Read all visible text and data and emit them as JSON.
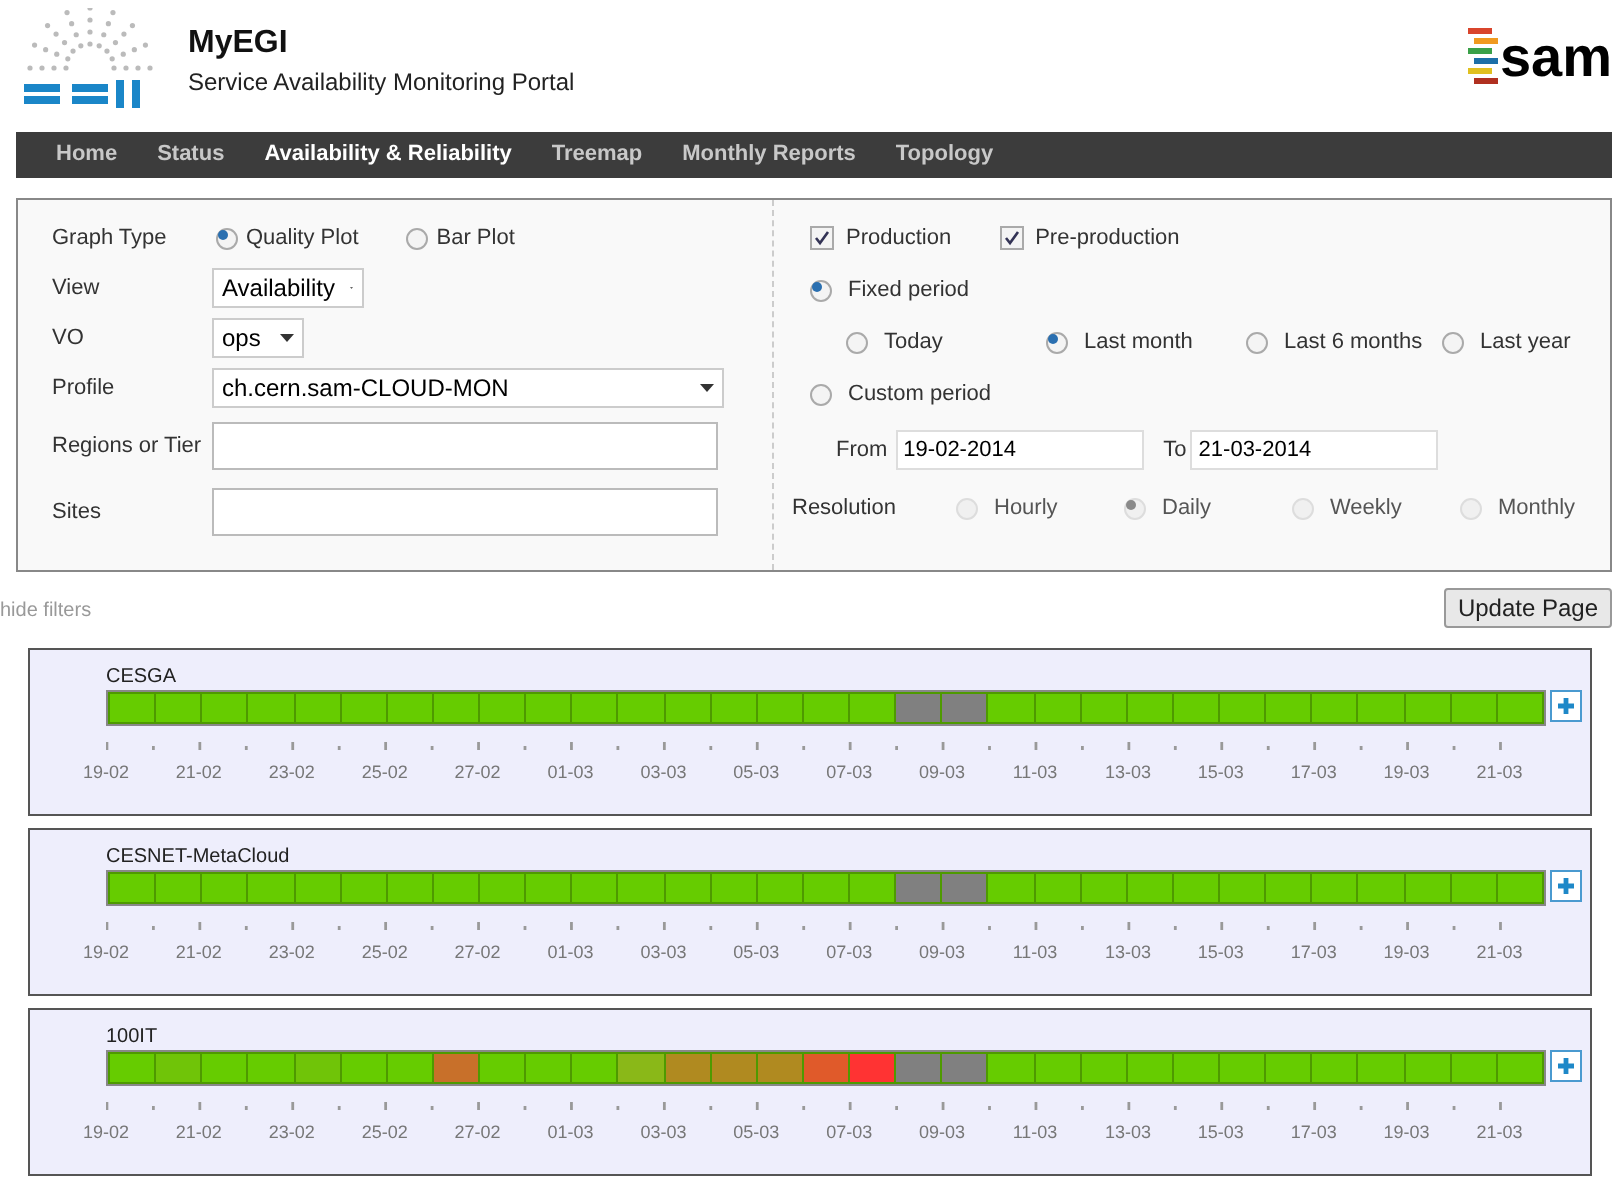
{
  "header": {
    "logo_text": "MyEGI",
    "subtitle": "Service Availability Monitoring Portal",
    "brand": "sam"
  },
  "nav": [
    {
      "label": "Home",
      "selected": false
    },
    {
      "label": "Status",
      "selected": false
    },
    {
      "label": "Availability & Reliability",
      "selected": true
    },
    {
      "label": "Treemap",
      "selected": false
    },
    {
      "label": "Monthly Reports",
      "selected": false
    },
    {
      "label": "Topology",
      "selected": false
    }
  ],
  "filters": {
    "graph_type": {
      "label": "Graph Type",
      "options": [
        {
          "label": "Quality Plot",
          "selected": true
        },
        {
          "label": "Bar Plot",
          "selected": false
        }
      ]
    },
    "view": {
      "label": "View",
      "value": "Availability"
    },
    "vo": {
      "label": "VO",
      "value": "ops"
    },
    "profile": {
      "label": "Profile",
      "value": "ch.cern.sam-CLOUD-MON"
    },
    "regions": {
      "label": "Regions or Tier"
    },
    "sites": {
      "label": "Sites"
    },
    "checks": [
      {
        "label": "Production",
        "checked": true
      },
      {
        "label": "Pre-production",
        "checked": true
      }
    ],
    "fixed_period": {
      "label": "Fixed period",
      "selected": true,
      "options": [
        {
          "label": "Today",
          "selected": false
        },
        {
          "label": "Last month",
          "selected": true
        },
        {
          "label": "Last 6 months",
          "selected": false
        },
        {
          "label": "Last year",
          "selected": false
        }
      ]
    },
    "custom_period": {
      "label": "Custom period",
      "selected": false,
      "from_label": "From",
      "from": "19-02-2014",
      "to_label": "To",
      "to": "21-03-2014"
    },
    "resolution": {
      "label": "Resolution",
      "disabled": true,
      "options": [
        {
          "label": "Hourly",
          "selected": false
        },
        {
          "label": "Daily",
          "selected": true
        },
        {
          "label": "Weekly",
          "selected": false
        },
        {
          "label": "Monthly",
          "selected": false
        }
      ]
    }
  },
  "hide_filters": "hide filters",
  "update_button": "Update Page",
  "sites": [
    {
      "name": "CESGA",
      "days": [
        {
          "color": "#66cc00"
        },
        {
          "color": "#66cc00"
        },
        {
          "color": "#66cc00"
        },
        {
          "color": "#66cc00"
        },
        {
          "color": "#66cc00"
        },
        {
          "color": "#66cc00"
        },
        {
          "color": "#66cc00"
        },
        {
          "color": "#66cc00"
        },
        {
          "color": "#66cc00"
        },
        {
          "color": "#66cc00"
        },
        {
          "color": "#66cc00"
        },
        {
          "color": "#66cc00"
        },
        {
          "color": "#66cc00"
        },
        {
          "color": "#66cc00"
        },
        {
          "color": "#66cc00"
        },
        {
          "color": "#66cc00"
        },
        {
          "color": "#66cc00"
        },
        {
          "color": "#808080"
        },
        {
          "color": "#808080"
        },
        {
          "color": "#66cc00"
        },
        {
          "color": "#66cc00"
        },
        {
          "color": "#66cc00"
        },
        {
          "color": "#66cc00"
        },
        {
          "color": "#66cc00"
        },
        {
          "color": "#66cc00"
        },
        {
          "color": "#66cc00"
        },
        {
          "color": "#66cc00"
        },
        {
          "color": "#66cc00"
        },
        {
          "color": "#66cc00"
        },
        {
          "color": "#66cc00"
        },
        {
          "color": "#66cc00"
        }
      ],
      "ticks": [
        "19-02",
        "21-02",
        "23-02",
        "25-02",
        "27-02",
        "01-03",
        "03-03",
        "05-03",
        "07-03",
        "09-03",
        "11-03",
        "13-03",
        "15-03",
        "17-03",
        "19-03",
        "21-03"
      ]
    },
    {
      "name": "CESNET-MetaCloud",
      "days": [
        {
          "color": "#66cc00"
        },
        {
          "color": "#66cc00"
        },
        {
          "color": "#66cc00"
        },
        {
          "color": "#66cc00"
        },
        {
          "color": "#66cc00"
        },
        {
          "color": "#66cc00"
        },
        {
          "color": "#66cc00"
        },
        {
          "color": "#66cc00"
        },
        {
          "color": "#66cc00"
        },
        {
          "color": "#66cc00"
        },
        {
          "color": "#66cc00"
        },
        {
          "color": "#66cc00"
        },
        {
          "color": "#66cc00"
        },
        {
          "color": "#66cc00"
        },
        {
          "color": "#66cc00"
        },
        {
          "color": "#66cc00"
        },
        {
          "color": "#66cc00"
        },
        {
          "color": "#808080"
        },
        {
          "color": "#808080"
        },
        {
          "color": "#66cc00"
        },
        {
          "color": "#66cc00"
        },
        {
          "color": "#66cc00"
        },
        {
          "color": "#66cc00"
        },
        {
          "color": "#66cc00"
        },
        {
          "color": "#66cc00"
        },
        {
          "color": "#66cc00"
        },
        {
          "color": "#66cc00"
        },
        {
          "color": "#66cc00"
        },
        {
          "color": "#66cc00"
        },
        {
          "color": "#66cc00"
        },
        {
          "color": "#66cc00"
        }
      ],
      "ticks": [
        "19-02",
        "21-02",
        "23-02",
        "25-02",
        "27-02",
        "01-03",
        "03-03",
        "05-03",
        "07-03",
        "09-03",
        "11-03",
        "13-03",
        "15-03",
        "17-03",
        "19-03",
        "21-03"
      ]
    },
    {
      "name": "100IT",
      "days": [
        {
          "color": "#66cc00"
        },
        {
          "color": "#70c408"
        },
        {
          "color": "#66cc00"
        },
        {
          "color": "#66cc00"
        },
        {
          "color": "#70c408"
        },
        {
          "color": "#66cc00"
        },
        {
          "color": "#66cc00"
        },
        {
          "color": "#c8702a"
        },
        {
          "color": "#66cc00"
        },
        {
          "color": "#66cc00"
        },
        {
          "color": "#66cc00"
        },
        {
          "color": "#8ab818"
        },
        {
          "color": "#b08a20"
        },
        {
          "color": "#b08a20"
        },
        {
          "color": "#b08a20"
        },
        {
          "color": "#e05a2a"
        },
        {
          "color": "#ff3333"
        },
        {
          "color": "#808080"
        },
        {
          "color": "#808080"
        },
        {
          "color": "#66cc00"
        },
        {
          "color": "#66cc00"
        },
        {
          "color": "#66cc00"
        },
        {
          "color": "#66cc00"
        },
        {
          "color": "#66cc00"
        },
        {
          "color": "#66cc00"
        },
        {
          "color": "#66cc00"
        },
        {
          "color": "#66cc00"
        },
        {
          "color": "#66cc00"
        },
        {
          "color": "#66cc00"
        },
        {
          "color": "#66cc00"
        },
        {
          "color": "#66cc00"
        }
      ],
      "ticks": [
        "19-02",
        "21-02",
        "23-02",
        "25-02",
        "27-02",
        "01-03",
        "03-03",
        "05-03",
        "07-03",
        "09-03",
        "11-03",
        "13-03",
        "15-03",
        "17-03",
        "19-03",
        "21-03"
      ]
    }
  ]
}
